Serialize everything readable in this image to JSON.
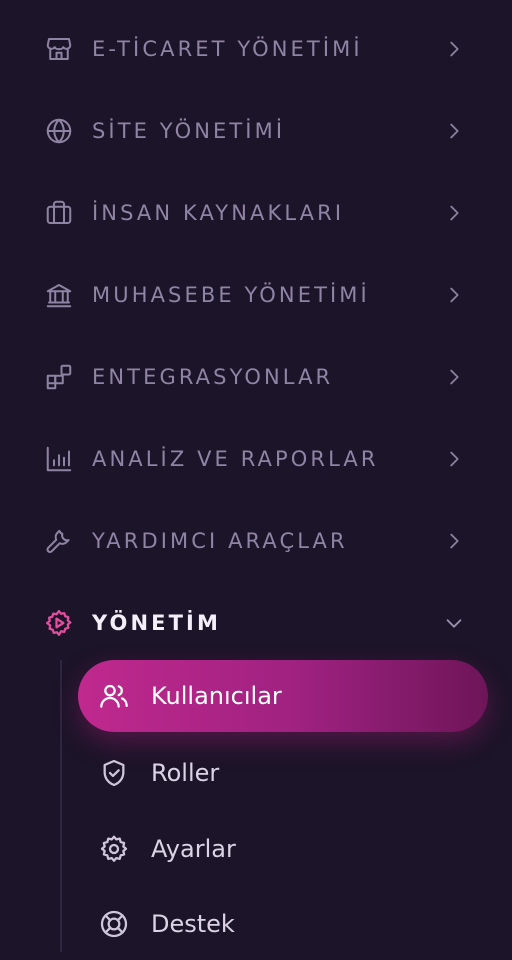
{
  "menu": {
    "items": [
      {
        "label": "E-TİCARET YÖNETİMİ",
        "icon": "store-icon"
      },
      {
        "label": "SİTE YÖNETİMİ",
        "icon": "globe-icon"
      },
      {
        "label": "İNSAN KAYNAKLARI",
        "icon": "briefcase-icon"
      },
      {
        "label": "MUHASEBE YÖNETİMİ",
        "icon": "bank-icon"
      },
      {
        "label": "ENTEGRASYONLAR",
        "icon": "integrations-icon"
      },
      {
        "label": "ANALİZ VE RAPORLAR",
        "icon": "bar-chart-icon"
      },
      {
        "label": "YARDIMCI ARAÇLAR",
        "icon": "wrench-icon"
      },
      {
        "label": "YÖNETİM",
        "icon": "settings-play-icon",
        "expanded": true
      }
    ],
    "submenu": [
      {
        "label": "Kullanıcılar",
        "icon": "users-icon",
        "active": true
      },
      {
        "label": "Roller",
        "icon": "shield-check-icon"
      },
      {
        "label": "Ayarlar",
        "icon": "gear-icon"
      },
      {
        "label": "Destek",
        "icon": "lifebuoy-icon"
      }
    ]
  },
  "colors": {
    "background": "#1c1428",
    "muted_text": "#8f84a5",
    "active_accent": "#e0509f",
    "active_gradient_start": "#c0298e",
    "active_gradient_end": "#6e1558"
  }
}
